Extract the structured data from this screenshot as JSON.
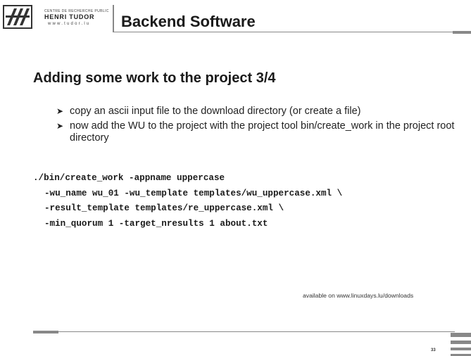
{
  "header": {
    "logo": {
      "small_text": "CENTRE DE RECHERCHE PUBLIC",
      "name": "HENRI TUDOR",
      "website": "www.tudor.lu"
    },
    "title": "Backend Software"
  },
  "slide": {
    "title": "Adding some work to the project 3/4",
    "bullets": [
      {
        "marker": "➤",
        "text": "copy an ascii input file to the download directory (or create a file)"
      },
      {
        "marker": "➤",
        "text": "now add the WU to the project with the project tool bin/create_work in the project root directory"
      }
    ],
    "code_lines": [
      "./bin/create_work -appname uppercase",
      "-wu_name wu_01 -wu_template templates/wu_uppercase.xml \\",
      "-result_template templates/re_uppercase.xml \\",
      "-min_quorum 1 -target_nresults 1 about.txt"
    ],
    "footnote": "available on www.linuxdays.lu/downloads"
  },
  "footer": {
    "page_number": "33"
  },
  "colors": {
    "text": "#1a1a1a",
    "rule": "#888888",
    "background": "#ffffff"
  }
}
